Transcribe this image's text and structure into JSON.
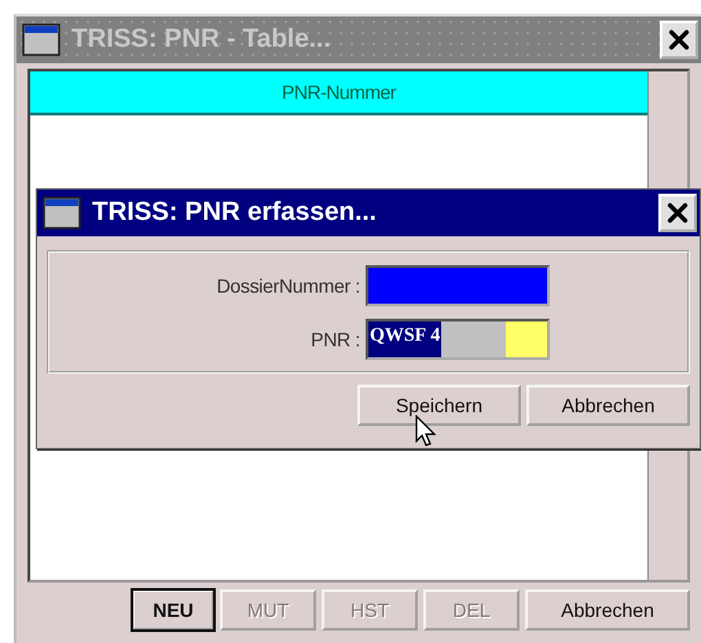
{
  "window": {
    "title": "TRISS: PNR - Table...",
    "active": false
  },
  "table": {
    "columns": [
      "PNR-Nummer"
    ]
  },
  "buttons": [
    {
      "label": "NEU",
      "default": true,
      "disabled": false
    },
    {
      "label": "MUT",
      "default": false,
      "disabled": true
    },
    {
      "label": "HST",
      "default": false,
      "disabled": true
    },
    {
      "label": "DEL",
      "default": false,
      "disabled": true
    },
    {
      "label": "Abbrechen",
      "default": false,
      "disabled": false
    }
  ],
  "dialog": {
    "title": "TRISS: PNR erfassen...",
    "active": true,
    "fields": [
      {
        "label": "DossierNummer :",
        "color": "#0000ff"
      },
      {
        "label": "PNR :",
        "value": "QWSF 4",
        "selected": true,
        "color": "#ffff66"
      }
    ],
    "buttons": [
      {
        "label": "Speichern"
      },
      {
        "label": "Abbrechen"
      }
    ]
  }
}
